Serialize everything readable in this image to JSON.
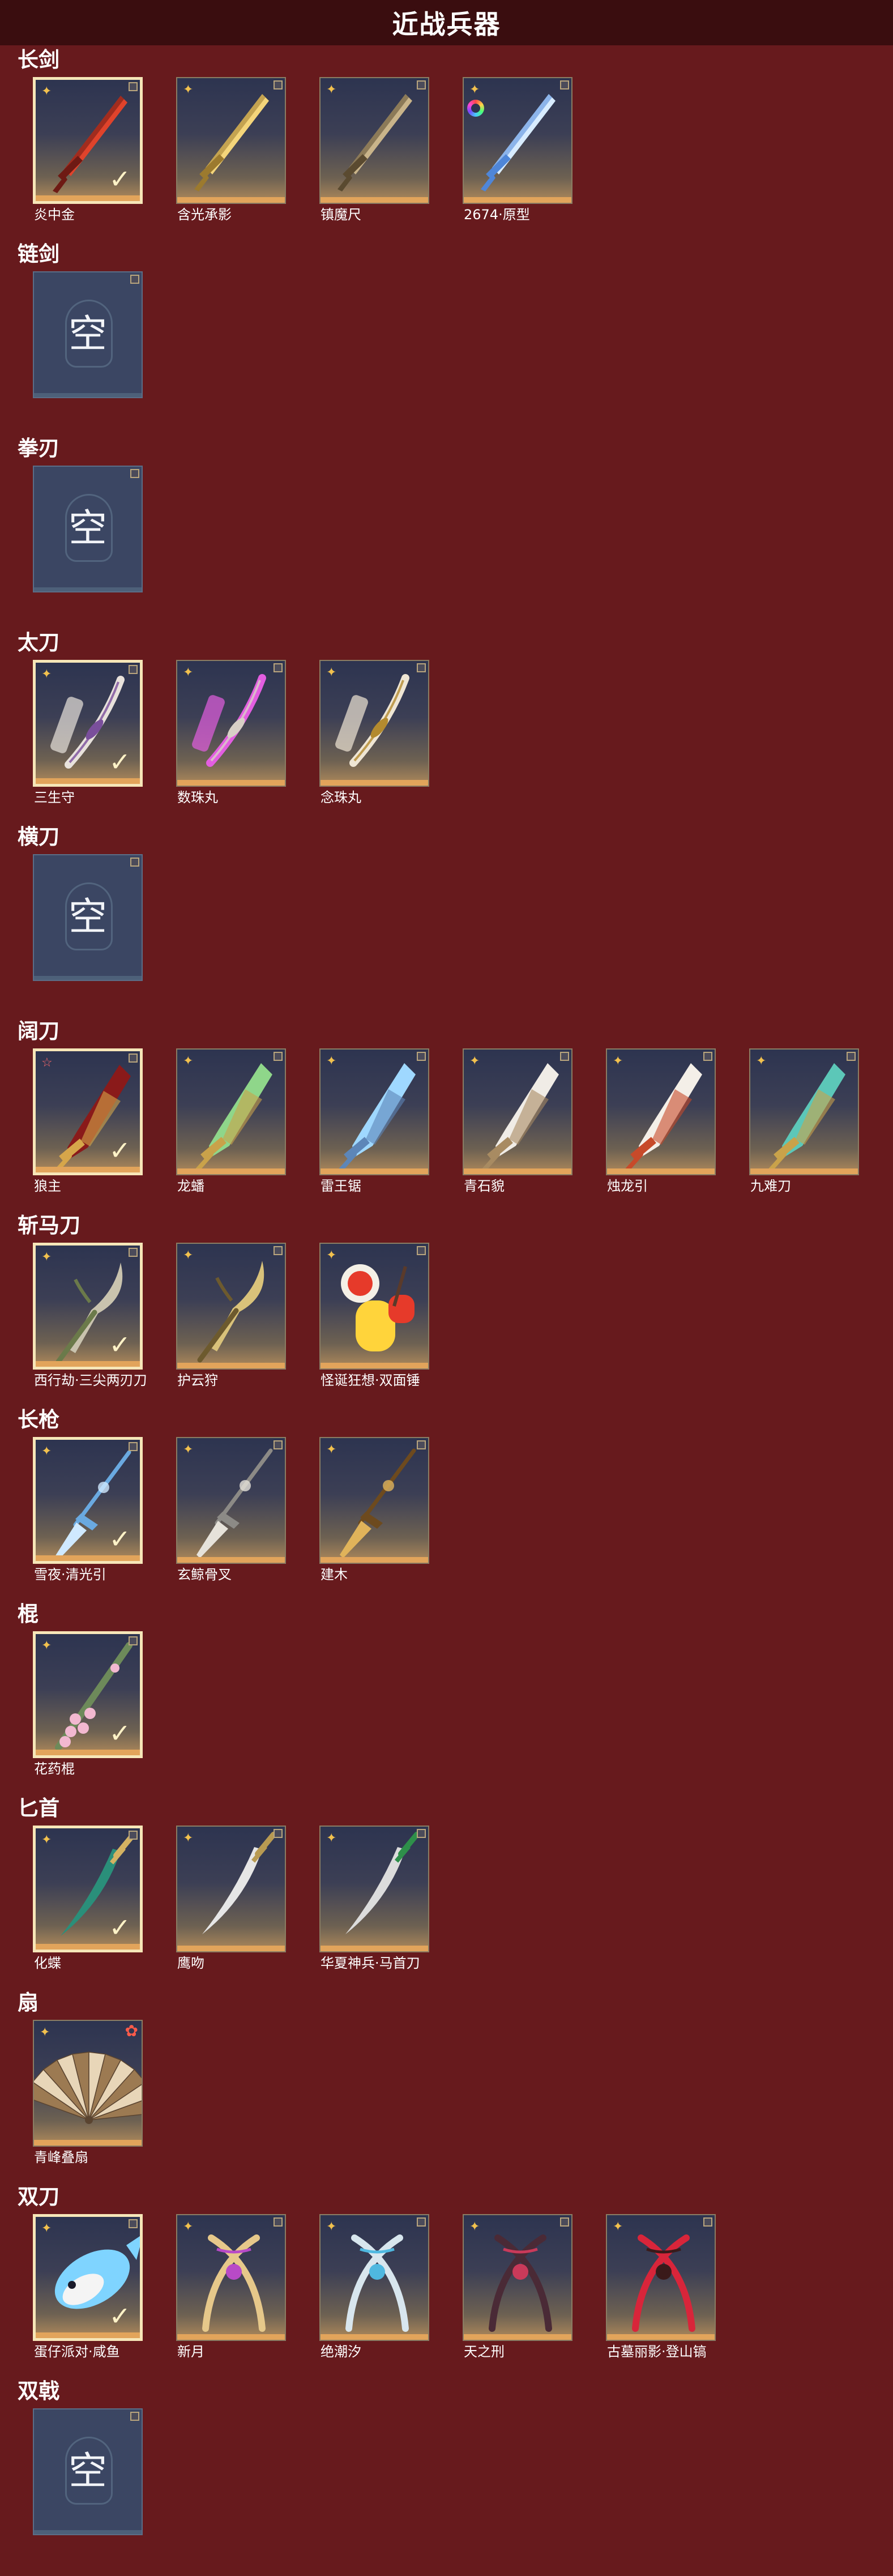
{
  "header": {
    "title": "近战兵器"
  },
  "empty_label": "空",
  "colors": {
    "background": "#671a1d",
    "header": "#3a0d0f",
    "rarity_gold": "#f2c14e",
    "rarity_red": "#ff6a6a",
    "equipped_border": "#f6e6b8"
  },
  "sections": [
    {
      "title": "长剑",
      "items": [
        {
          "label": "炎中金",
          "equipped": true,
          "rarity": "gold",
          "icon": "flame-sword-icon",
          "c1": "#e0432b",
          "c2": "#6e1a14",
          "shape": "sword"
        },
        {
          "label": "含光承影",
          "equipped": false,
          "rarity": "gold",
          "icon": "golden-sword-icon",
          "c1": "#f4d57a",
          "c2": "#9c7a2e",
          "shape": "sword"
        },
        {
          "label": "镇魔尺",
          "equipped": false,
          "rarity": "gold",
          "icon": "dark-sword-icon",
          "c1": "#c9b48a",
          "c2": "#5a4a30",
          "shape": "sword"
        },
        {
          "label": "2674·原型",
          "equipped": false,
          "rarity": "gold",
          "icon": "light-sword-icon",
          "c1": "#d8ecff",
          "c2": "#4f86d8",
          "shape": "sword",
          "color_ring": true
        }
      ]
    },
    {
      "title": "链剑",
      "items": [
        {
          "empty": true
        }
      ]
    },
    {
      "title": "拳刃",
      "items": [
        {
          "empty": true
        }
      ]
    },
    {
      "title": "太刀",
      "items": [
        {
          "label": "三生守",
          "equipped": true,
          "rarity": "gold",
          "icon": "pale-katana-icon",
          "c1": "#e8e2dc",
          "c2": "#7a4f9c",
          "shape": "katana"
        },
        {
          "label": "数珠丸",
          "equipped": false,
          "rarity": "gold",
          "icon": "purple-katana-icon",
          "c1": "#e35ee0",
          "c2": "#d8d0c6",
          "shape": "katana"
        },
        {
          "label": "念珠丸",
          "equipped": false,
          "rarity": "gold",
          "icon": "white-katana-icon",
          "c1": "#efe6d4",
          "c2": "#b38a2e",
          "shape": "katana"
        }
      ]
    },
    {
      "title": "横刀",
      "items": [
        {
          "empty": true
        }
      ]
    },
    {
      "title": "阔刀",
      "items": [
        {
          "label": "狼主",
          "equipped": true,
          "rarity": "red",
          "icon": "crimson-broadblade-icon",
          "c1": "#8a1a1a",
          "c2": "#d6a64a",
          "shape": "broad"
        },
        {
          "label": "龙蟠",
          "equipped": false,
          "rarity": "gold",
          "icon": "jade-broadblade-icon",
          "c1": "#8fd68a",
          "c2": "#c9a24a",
          "shape": "broad"
        },
        {
          "label": "雷王锯",
          "equipped": false,
          "rarity": "gold",
          "icon": "lightning-broadblade-icon",
          "c1": "#9fd8ff",
          "c2": "#5d86b8",
          "shape": "broad"
        },
        {
          "label": "青石貌",
          "equipped": false,
          "rarity": "gold",
          "icon": "stone-broadblade-icon",
          "c1": "#f0ece6",
          "c2": "#a88b62",
          "shape": "broad"
        },
        {
          "label": "烛龙引",
          "equipped": false,
          "rarity": "gold",
          "icon": "dragon-broadblade-icon",
          "c1": "#f4efe8",
          "c2": "#c74a2a",
          "shape": "broad"
        },
        {
          "label": "九难刀",
          "equipped": false,
          "rarity": "gold",
          "icon": "teal-broadblade-icon",
          "c1": "#5cc7b8",
          "c2": "#c9a24a",
          "shape": "broad"
        }
      ]
    },
    {
      "title": "斩马刀",
      "items": [
        {
          "label": "西行劫·三尖两刃刀",
          "equipped": true,
          "rarity": "gold",
          "icon": "trident-blade-icon",
          "c1": "#c9c3ae",
          "c2": "#6b7a4a",
          "shape": "blade"
        },
        {
          "label": "护云狩",
          "equipped": false,
          "rarity": "gold",
          "icon": "gold-polearm-icon",
          "c1": "#d9c27a",
          "c2": "#6d5a2e",
          "shape": "blade"
        },
        {
          "label": "怪诞狂想·双面锤",
          "equipped": false,
          "rarity": "gold",
          "icon": "toy-hammer-icon",
          "c1": "#ffd43b",
          "c2": "#e63a2a",
          "shape": "toy"
        }
      ]
    },
    {
      "title": "长枪",
      "items": [
        {
          "label": "雪夜·清光引",
          "equipped": true,
          "rarity": "gold",
          "icon": "ice-spear-icon",
          "c1": "#cfe9ff",
          "c2": "#6aa9e0",
          "shape": "spear"
        },
        {
          "label": "玄鲸骨叉",
          "equipped": false,
          "rarity": "gold",
          "icon": "bone-trident-icon",
          "c1": "#e6e2da",
          "c2": "#8c8a86",
          "shape": "spear"
        },
        {
          "label": "建木",
          "equipped": false,
          "rarity": "gold",
          "icon": "wood-spear-icon",
          "c1": "#e0b35a",
          "c2": "#6d4a1e",
          "shape": "spear"
        }
      ]
    },
    {
      "title": "棍",
      "items": [
        {
          "label": "花药棍",
          "equipped": true,
          "rarity": "gold",
          "icon": "blossom-staff-icon",
          "c1": "#f2b8d0",
          "c2": "#6d8a5a",
          "shape": "staff"
        }
      ]
    },
    {
      "title": "匕首",
      "items": [
        {
          "label": "化蝶",
          "equipped": true,
          "rarity": "gold",
          "icon": "butterfly-dagger-icon",
          "c1": "#2a8f7a",
          "c2": "#d4b262",
          "shape": "dagger"
        },
        {
          "label": "鹰吻",
          "equipped": false,
          "rarity": "gold",
          "icon": "curved-dagger-icon",
          "c1": "#e6e6e6",
          "c2": "#b89a52",
          "shape": "dagger"
        },
        {
          "label": "华夏神兵·马首刀",
          "equipped": false,
          "rarity": "gold",
          "icon": "horse-dagger-icon",
          "c1": "#dcdcdc",
          "c2": "#2e8f4a",
          "shape": "dagger"
        }
      ]
    },
    {
      "title": "扇",
      "items": [
        {
          "label": "青峰叠扇",
          "equipped": false,
          "rarity": "gold",
          "icon": "folding-fan-icon",
          "c1": "#e8d6b8",
          "c2": "#9c7a52",
          "shape": "fan",
          "flower_badge": true
        }
      ]
    },
    {
      "title": "双刀",
      "items": [
        {
          "label": "蛋仔派对·咸鱼",
          "equipped": true,
          "rarity": "gold",
          "icon": "fish-blade-icon",
          "c1": "#7fd4ff",
          "c2": "#f4f4f4",
          "shape": "fish"
        },
        {
          "label": "新月",
          "equipped": false,
          "rarity": "gold",
          "icon": "crescent-blade-icon",
          "c1": "#e6c88a",
          "c2": "#b84ac7",
          "shape": "dual"
        },
        {
          "label": "绝潮汐",
          "equipped": false,
          "rarity": "gold",
          "icon": "tide-blade-icon",
          "c1": "#d8e6ee",
          "c2": "#4fb8e0",
          "shape": "dual"
        },
        {
          "label": "天之刑",
          "equipped": false,
          "rarity": "gold",
          "icon": "dark-dual-blade-icon",
          "c1": "#4a2a36",
          "c2": "#c93a5a",
          "shape": "dual"
        },
        {
          "label": "古墓丽影·登山镐",
          "equipped": false,
          "rarity": "gold",
          "icon": "ice-axe-icon",
          "c1": "#d8253a",
          "c2": "#3a1a1a",
          "shape": "dual"
        }
      ]
    },
    {
      "title": "双戟",
      "items": [
        {
          "empty": true
        }
      ]
    }
  ]
}
